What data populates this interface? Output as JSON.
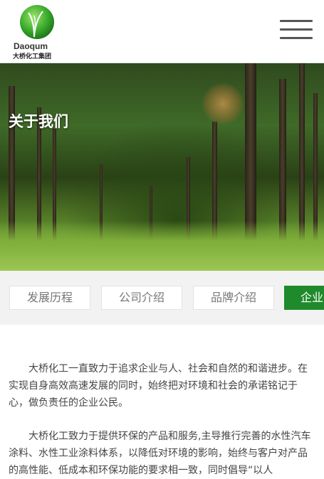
{
  "header": {
    "brand_en": "Daoqum",
    "brand_cn": "大桥化工集团",
    "logo_icon": "green-sphere-logo-icon",
    "menu_icon": "hamburger-menu-icon"
  },
  "banner": {
    "title": "关于我们"
  },
  "tabs": [
    {
      "label": "发展历程",
      "active": false
    },
    {
      "label": "公司介绍",
      "active": false
    },
    {
      "label": "品牌介绍",
      "active": false
    },
    {
      "label": "企业",
      "active": true
    }
  ],
  "content": {
    "paragraphs": [
      "大桥化工一直致力于追求企业与人、社会和自然的和谐进步。在实现自身高效高速发展的同时，始终把对环境和社会的承诺铭记于心，做负责任的企业公民。",
      "大桥化工致力于提供环保的产品和服务,主导推行完善的水性汽车涂料、水性工业涂料体系，以降低对环境的影响，始终与客户对产品的高性能、低成本和环保功能的要求相一致，同时倡导“以人"
    ]
  },
  "colors": {
    "accent": "#1f8a2b",
    "tab_bg": "#f2f2f2"
  }
}
